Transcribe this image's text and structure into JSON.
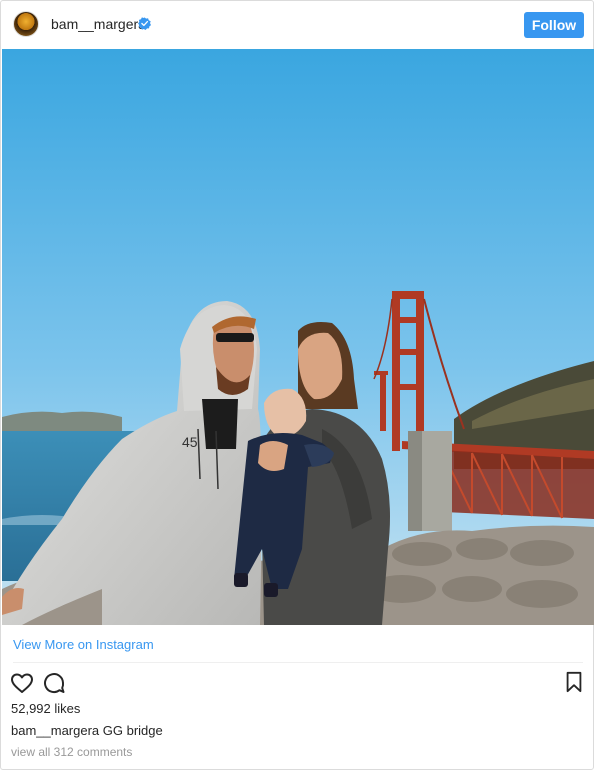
{
  "post": {
    "username": "bam__margera",
    "follow_label": "Follow",
    "view_more_label": "View More on Instagram",
    "likes_text": "52,992 likes",
    "caption_user": "bam__margera",
    "caption_text": " GG bridge",
    "view_comments_label": "view all 312 comments"
  },
  "icons": {
    "verified": "verified-badge-icon",
    "like": "heart-icon",
    "comment": "comment-icon",
    "save": "bookmark-icon"
  },
  "colors": {
    "accent": "#3897f0",
    "text": "#262626",
    "muted": "#999999"
  }
}
